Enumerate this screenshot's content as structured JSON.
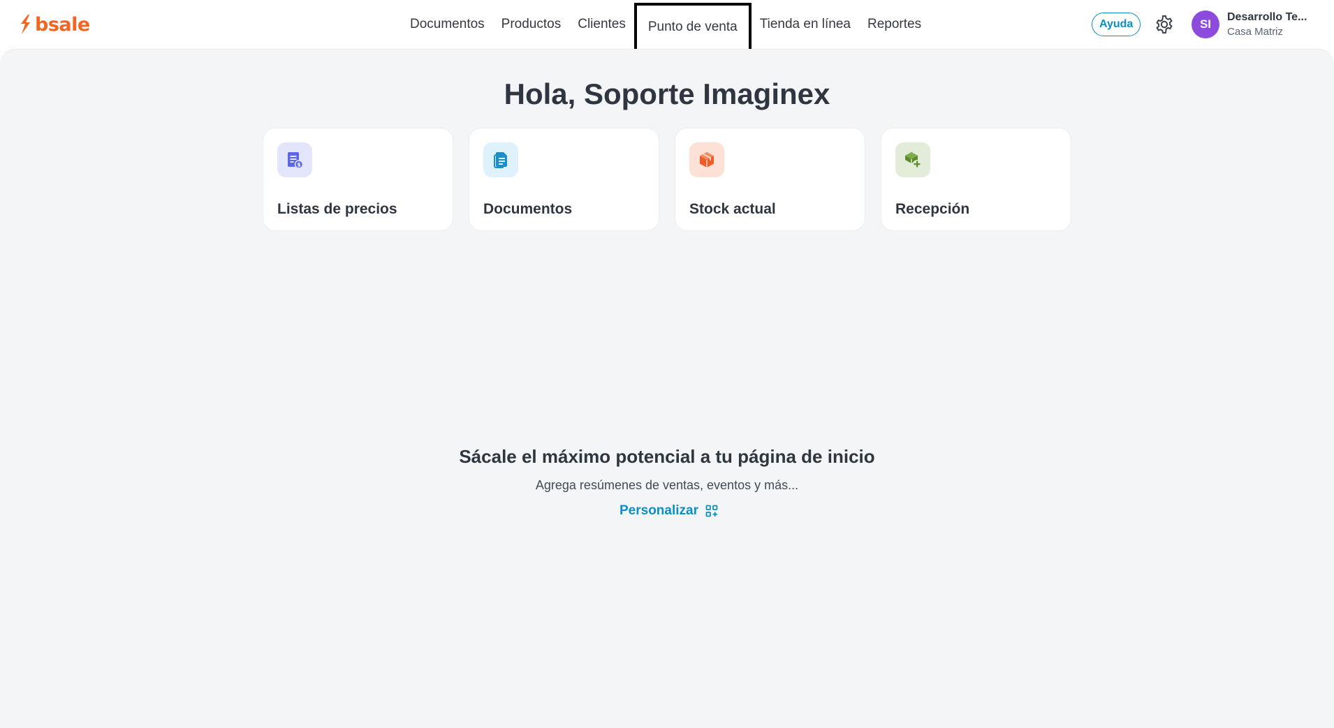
{
  "header": {
    "logo_text": "bsale",
    "nav": [
      "Documentos",
      "Productos",
      "Clientes",
      "Punto de venta",
      "Tienda en línea",
      "Reportes"
    ],
    "help_label": "Ayuda",
    "settings_icon": "gear-icon",
    "user": {
      "initials": "SI",
      "name": "Desarrollo Te...",
      "branch": "Casa Matriz"
    }
  },
  "main": {
    "greeting": "Hola, Soporte Imaginex",
    "shortcuts": [
      {
        "label": "Listas de precios",
        "icon": "price-list-icon",
        "color": "#5b67e6",
        "bg": "#e3e5fb"
      },
      {
        "label": "Documentos",
        "icon": "document-icon",
        "color": "#1b8fc9",
        "bg": "#dff1fa"
      },
      {
        "label": "Stock actual",
        "icon": "box-icon",
        "color": "#f05a28",
        "bg": "#fde0d6"
      },
      {
        "label": "Recepción",
        "icon": "box-add-icon",
        "color": "#5c8a2b",
        "bg": "#e2ecd8"
      }
    ],
    "promo": {
      "title": "Sácale el máximo potencial a tu página de inicio",
      "subtitle": "Agrega resúmenes de ventas, eventos y más...",
      "cta": "Personalizar"
    }
  },
  "colors": {
    "brand": "#f26522",
    "accent": "#0b8fc4",
    "avatar": "#8c4bdc",
    "background": "#f4f5f7"
  }
}
